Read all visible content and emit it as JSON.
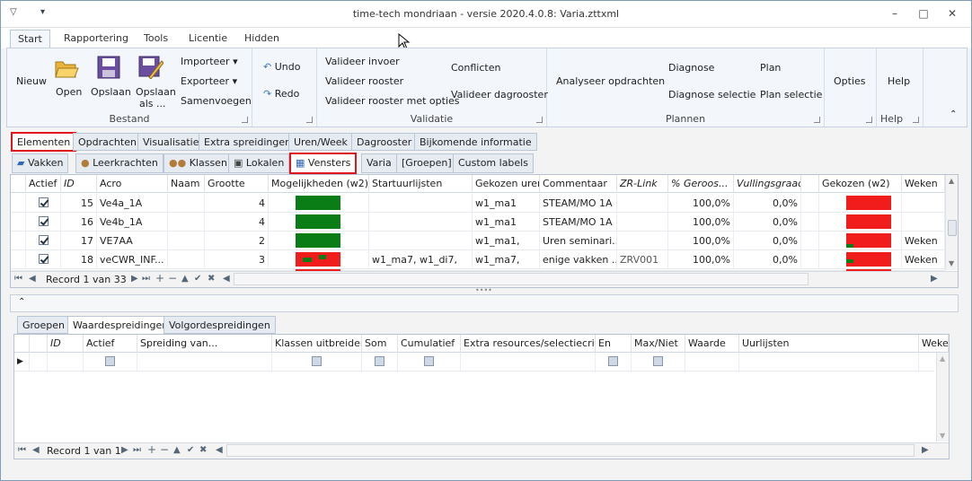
{
  "titlebar": {
    "title": "time-tech mondriaan - versie 2020.4.0.8: Varia.zttxml"
  },
  "ribbon_tabs": [
    "Start",
    "Rapportering",
    "Tools",
    "Licentie",
    "Hidden"
  ],
  "bestand": {
    "nieuw": "Nieuw",
    "open": "Open",
    "opslaan": "Opslaan",
    "opslaan_als_1": "Opslaan",
    "opslaan_als_2": "als ...",
    "importeer": "Importeer",
    "exporteer": "Exporteer",
    "samenvoegen": "Samenvoegen",
    "label": "Bestand"
  },
  "undo": {
    "undo": "Undo",
    "redo": "Redo"
  },
  "validatie": {
    "invoer": "Valideer invoer",
    "rooster": "Valideer rooster",
    "rooster_opties": "Valideer rooster met opties",
    "conflicten": "Conflicten",
    "dagrooster": "Valideer dagrooster",
    "label": "Validatie"
  },
  "plannen": {
    "analyseer": "Analyseer opdrachten",
    "diagnose": "Diagnose",
    "diagnose_selectie": "Diagnose selectie",
    "plan": "Plan",
    "plan_selectie": "Plan selectie",
    "label": "Plannen"
  },
  "opties": {
    "label": "Opties"
  },
  "help": {
    "btn": "Help",
    "label": "Help"
  },
  "main_tabs": [
    "Elementen",
    "Opdrachten",
    "Visualisatie",
    "Extra spreidingen",
    "Uren/Week",
    "Dagrooster",
    "Bijkomende informatie"
  ],
  "sub_tabs": [
    "Vakken",
    "Leerkrachten",
    "Klassen",
    "Lokalen",
    "Vensters",
    "Varia",
    "[Groepen]",
    "Custom labels"
  ],
  "grid1": {
    "headers": [
      "Actief",
      "ID",
      "Acro",
      "Naam",
      "Grootte",
      "Mogelijkheden (w2)",
      "Startuurlijsten",
      "Gekozen uren",
      "Commentaar",
      "ZR-Link",
      "% Geroos...",
      "Vullingsgraad",
      "",
      "Gekozen (w2)",
      "Weken"
    ],
    "rows": [
      {
        "id": "15",
        "acro": "Ve4a_1A",
        "grootte": "4",
        "start": "",
        "gekozen": "w1_ma1",
        "commentaar": "STEAM/MO 1A",
        "zr": "",
        "pct": "100,0%",
        "vul": "0,0%",
        "weken": ""
      },
      {
        "id": "16",
        "acro": "Ve4b_1A",
        "grootte": "4",
        "start": "",
        "gekozen": "w1_ma1",
        "commentaar": "STEAM/MO 1A",
        "zr": "",
        "pct": "100,0%",
        "vul": "0,0%",
        "weken": ""
      },
      {
        "id": "17",
        "acro": "VE7AA",
        "grootte": "2",
        "start": "",
        "gekozen": "w1_ma1,",
        "commentaar": "Uren seminari...",
        "zr": "",
        "pct": "100,0%",
        "vul": "0,0%",
        "weken": "Weken"
      },
      {
        "id": "18",
        "acro": "veCWR_INF...",
        "grootte": "3",
        "start": "w1_ma7, w1_di7,",
        "gekozen": "w1_ma7,",
        "commentaar": "enige vakken ...",
        "zr": "ZRV001",
        "pct": "100,0%",
        "vul": "0,0%",
        "weken": "Weken"
      }
    ],
    "record": "Record 1 van 33"
  },
  "lower_tabs": [
    "Groepen",
    "Waardespreidingen",
    "Volgordespreidingen"
  ],
  "grid2": {
    "headers": [
      "ID",
      "Actief",
      "Spreiding van...",
      "Klassen uitbreiden",
      "Som",
      "Cumulatief",
      "Extra resources/selectiecrit...",
      "En",
      "Max/Niet",
      "Waarde",
      "Uurlijsten",
      "Weken"
    ],
    "record": "Record 1 van 1"
  },
  "colors": {
    "green": "#0a7d16",
    "red": "#f11c1c",
    "redbox": "#e0141b"
  }
}
